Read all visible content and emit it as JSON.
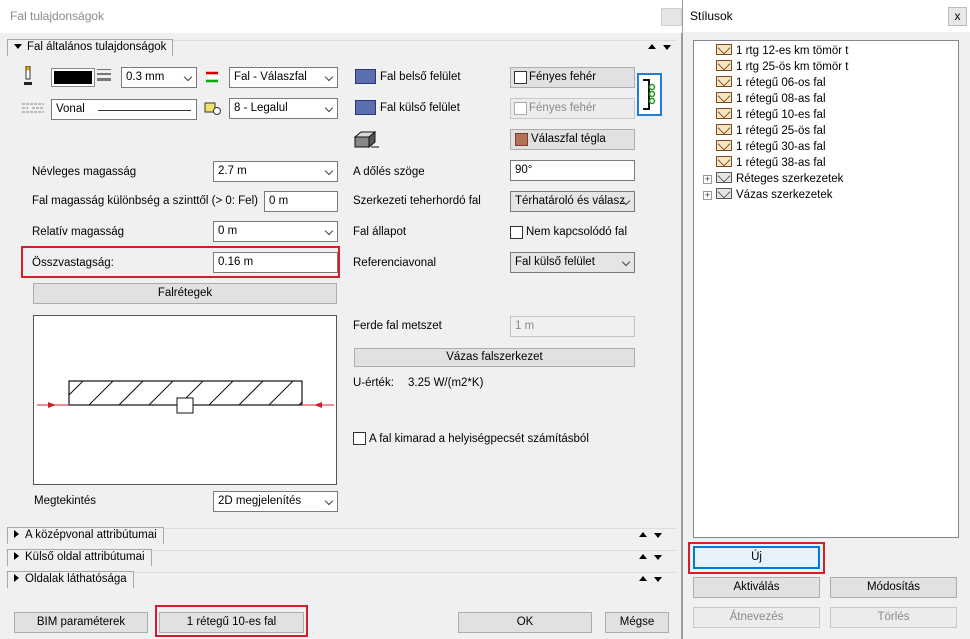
{
  "window": {
    "title": "Fal tulajdonságok"
  },
  "general_section": {
    "title": "Fal általános tulajdonságok"
  },
  "line": {
    "thickness": "0.3 mm",
    "type_label": "Vonal",
    "wall_type": "Fal - Válaszfal",
    "layer": "8 - Legalul"
  },
  "surfaces": {
    "inner_label": "Fal belső felület",
    "inner_value": "Fényes fehér",
    "outer_label": "Fal külső felület",
    "outer_value": "Fényes fehér",
    "material_value": "Válaszfal tégla"
  },
  "props": {
    "nominal_height_label": "Névleges magasság",
    "nominal_height": "2.7 m",
    "height_diff_label": "Fal magasság különbség a szinttől (> 0: Fel)",
    "height_diff": "0 m",
    "relative_height_label": "Relatív magasság",
    "relative_height": "0 m",
    "total_thickness_label": "Összvastagság:",
    "total_thickness": "0.16 m",
    "layers_button": "Falrétegek",
    "preview_label": "Megtekintés",
    "preview_mode": "2D megjelenítés"
  },
  "right_props": {
    "tilt_label": "A dőlés szöge",
    "tilt": "90°",
    "structural_label": "Szerkezeti teherhordó fal",
    "structural": "Térhatároló és válasz",
    "state_label": "Fal állapot",
    "state_checkbox": "Nem kapcsolódó fal",
    "ref_label": "Referenciavonal",
    "ref": "Fal külső felület",
    "oblique_label": "Ferde fal metszet",
    "oblique": "1 m",
    "frame_button": "Vázas falszerkezet",
    "u_label": "U-érték:",
    "u_value": "3.25 W/(m2*K)",
    "exclude_checkbox": "A fal kimarad a helyiségpecsét számításból"
  },
  "collapsed_sections": [
    "A középvonal attribútumai",
    "Külső oldal attribútumai",
    "Oldalak láthatósága"
  ],
  "footer": {
    "bim_button": "BIM paraméterek",
    "style_button": "1 rétegű 10-es fal",
    "ok_button": "OK",
    "cancel_button": "Mégse"
  },
  "styles": {
    "title": "Stílusok",
    "close": "x",
    "items": [
      "1 rtg 12-es km tömör t",
      "1 rtg 25-ös km tömör t",
      "1 rétegű 06-os fal",
      "1 rétegű 08-as fal",
      "1 rétegű 10-es fal",
      "1 rétegű 25-ös fal",
      "1 rétegű 30-as fal",
      "1 rétegű 38-as fal"
    ],
    "groups": [
      "Réteges szerkezetek",
      "Vázas szerkezetek"
    ],
    "new_button": "Új",
    "activate_button": "Aktiválás",
    "modify_button": "Módosítás",
    "rename_button": "Átnevezés",
    "delete_button": "Törlés"
  },
  "colors": {
    "highlight_red": "#d61d2c",
    "wall_icon_blue": "#5b6fae",
    "accent_blue": "#0078d7"
  }
}
